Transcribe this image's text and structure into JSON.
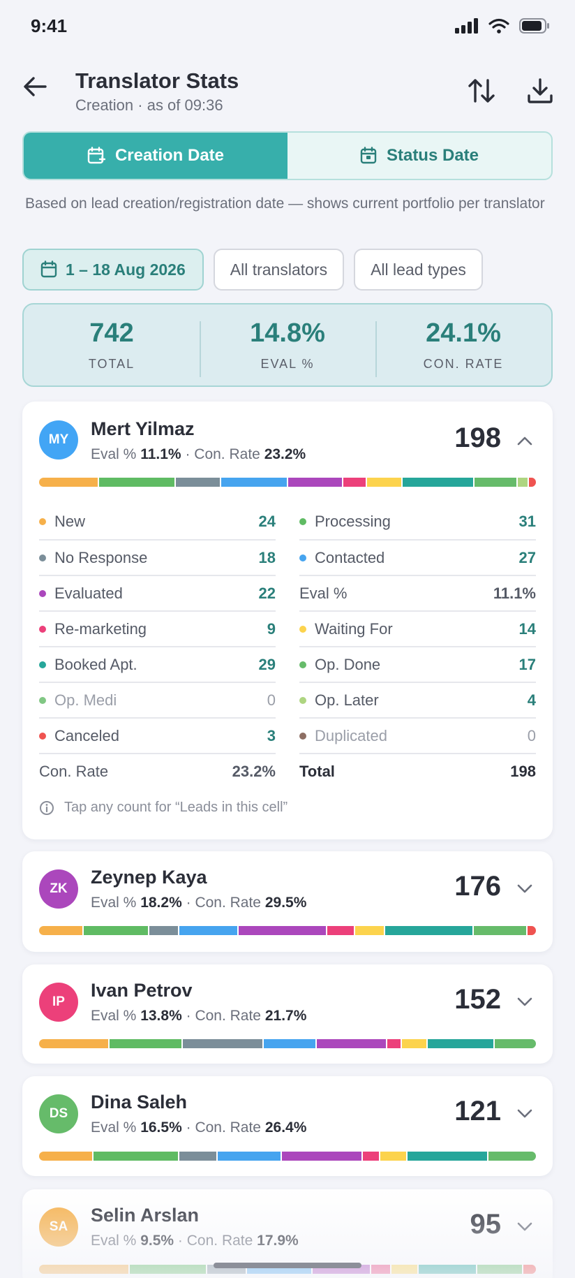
{
  "status": {
    "time": "9:41"
  },
  "header": {
    "title": "Translator Stats",
    "subtitle": "Creation · as of 09:36"
  },
  "segments": [
    {
      "label": "Creation Date",
      "active": true
    },
    {
      "label": "Status Date",
      "active": false
    }
  ],
  "description": "Based on lead creation/registration date — shows current portfolio per translator",
  "filters": {
    "date": "1 – 18 Aug 2026",
    "translators": "All translators",
    "lead_types": "All lead types"
  },
  "summary": [
    {
      "value": "742",
      "label": "TOTAL"
    },
    {
      "value": "14.8%",
      "label": "EVAL %"
    },
    {
      "value": "24.1%",
      "label": "CON. RATE"
    }
  ],
  "colors": {
    "new": "#f6b04a",
    "processing": "#5fbb63",
    "no_response": "#7b8e99",
    "contacted": "#46a4ef",
    "evaluated": "#ab47bc",
    "remarketing": "#ec407a",
    "waiting": "#fcd34d",
    "booked": "#26a69a",
    "op_done": "#66bb6a",
    "op_medi": "#81c784",
    "op_later": "#aed581",
    "canceled": "#ef5350",
    "duplicated": "#8d6e63"
  },
  "metric_labels": {
    "eval": "Eval %",
    "sep": "·",
    "con": "Con. Rate"
  },
  "cards": [
    {
      "initials": "MY",
      "name": "Mert Yilmaz",
      "eval": "11.1%",
      "con": "23.2%",
      "total": "198",
      "expanded": true,
      "avatar_color": "#42a5f5",
      "left": [
        {
          "label": "New",
          "count": "24",
          "color": "#f6b04a"
        },
        {
          "label": "No Response",
          "count": "18",
          "color": "#7b8e99"
        },
        {
          "label": "Evaluated",
          "count": "22",
          "color": "#ab47bc"
        },
        {
          "label": "Re-marketing",
          "count": "9",
          "color": "#ec407a"
        },
        {
          "label": "Booked Apt.",
          "count": "29",
          "color": "#26a69a"
        },
        {
          "label": "Op. Medi",
          "count": "0",
          "color": "#81c784",
          "muted": true
        },
        {
          "label": "Canceled",
          "count": "3",
          "color": "#ef5350"
        },
        {
          "label": "Con. Rate",
          "count": "23.2%",
          "summary": true
        }
      ],
      "right": [
        {
          "label": "Processing",
          "count": "31",
          "color": "#5fbb63"
        },
        {
          "label": "Contacted",
          "count": "27",
          "color": "#46a4ef"
        },
        {
          "label": "Eval %",
          "count": "11.1%",
          "summary": true
        },
        {
          "label": "Waiting For",
          "count": "14",
          "color": "#fcd34d"
        },
        {
          "label": "Op. Done",
          "count": "17",
          "color": "#66bb6a"
        },
        {
          "label": "Op. Later",
          "count": "4",
          "color": "#aed581"
        },
        {
          "label": "Duplicated",
          "count": "0",
          "color": "#8d6e63",
          "muted": true
        },
        {
          "label": "Total",
          "count": "198",
          "total": true
        }
      ],
      "hint": "Tap any count for “Leads in this cell”",
      "bar": [
        24,
        31,
        18,
        27,
        22,
        9,
        14,
        29,
        17,
        4,
        3
      ]
    },
    {
      "initials": "ZK",
      "name": "Zeynep Kaya",
      "eval": "18.2%",
      "con": "29.5%",
      "total": "176",
      "avatar_color": "#ab47bc",
      "bar": [
        15,
        22,
        10,
        20,
        30,
        9,
        10,
        30,
        18,
        3
      ]
    },
    {
      "initials": "IP",
      "name": "Ivan Petrov",
      "eval": "13.8%",
      "con": "21.7%",
      "total": "152",
      "avatar_color": "#ec407a",
      "bar": [
        20,
        21,
        23,
        15,
        20,
        4,
        7,
        19,
        12
      ]
    },
    {
      "initials": "DS",
      "name": "Dina Saleh",
      "eval": "16.5%",
      "con": "26.4%",
      "total": "121",
      "avatar_color": "#66bb6a",
      "bar": [
        10,
        16,
        7,
        12,
        15,
        3,
        5,
        15,
        9
      ]
    },
    {
      "initials": "SA",
      "name": "Selin Arslan",
      "eval": "9.5%",
      "con": "17.9%",
      "total": "95",
      "avatar_color": "#f6b04a",
      "bar": [
        14,
        12,
        6,
        10,
        9,
        3,
        4,
        9,
        7,
        2
      ]
    }
  ]
}
